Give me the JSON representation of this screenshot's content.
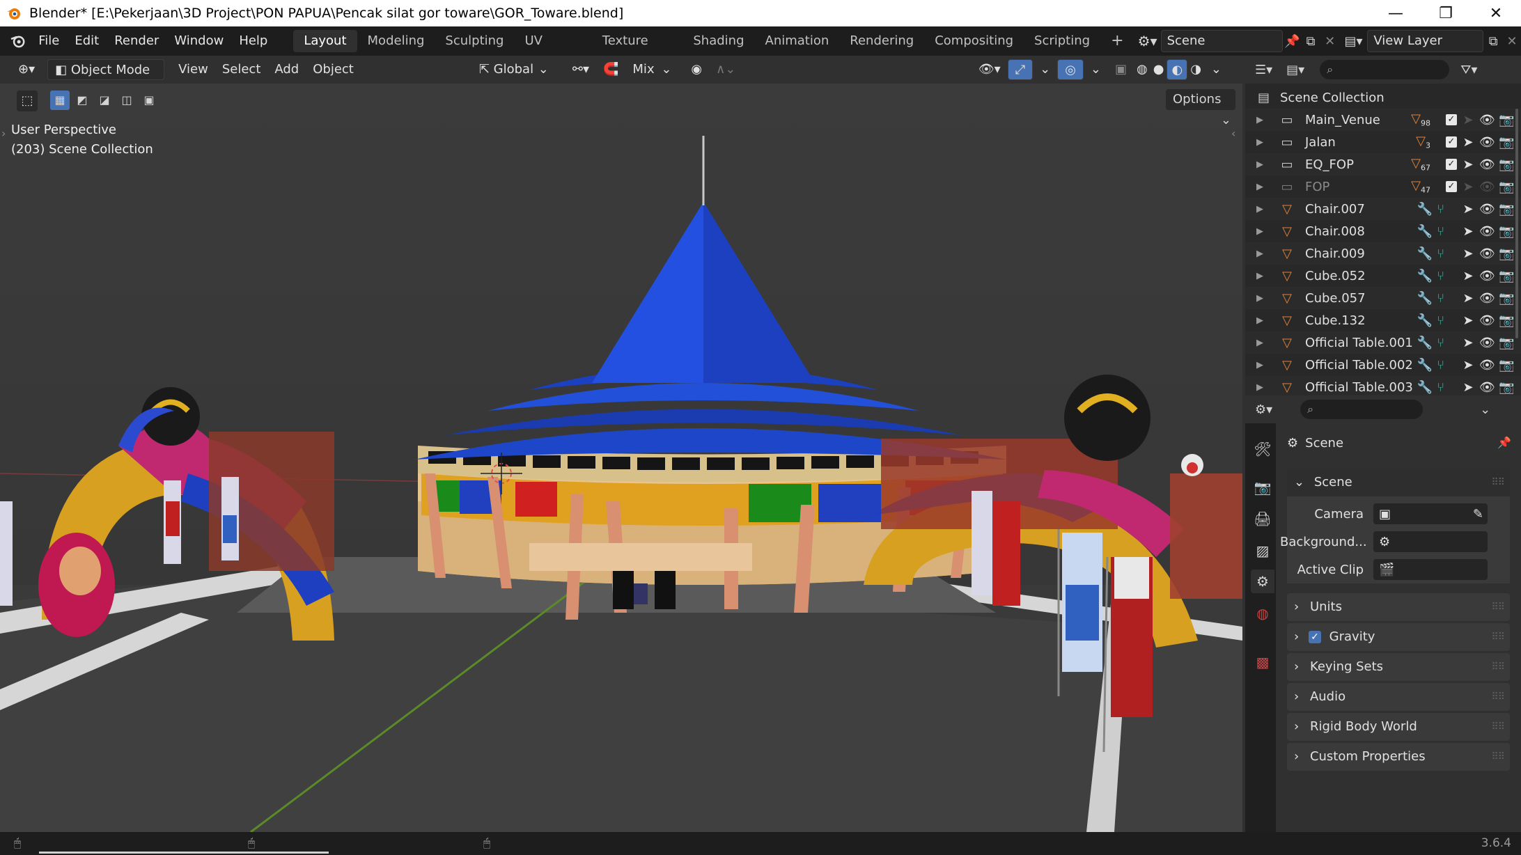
{
  "window": {
    "title": "Blender* [E:\\Pekerjaan\\3D Project\\PON PAPUA\\Pencak silat gor toware\\GOR_Toware.blend]",
    "min_label": "—",
    "max_label": "❐",
    "close_label": "✕"
  },
  "menu": {
    "items": [
      "File",
      "Edit",
      "Render",
      "Window",
      "Help"
    ],
    "workspaces": [
      "Layout",
      "Modeling",
      "Sculpting",
      "UV Editing",
      "Texture Paint",
      "Shading",
      "Animation",
      "Rendering",
      "Compositing",
      "Scripting"
    ],
    "add_tab": "+",
    "scene_name": "Scene",
    "view_layer": "View Layer"
  },
  "header": {
    "mode": "Object Mode",
    "view": "View",
    "select": "Select",
    "add": "Add",
    "object": "Object",
    "orientation": "Global",
    "pivot_mix": "Mix",
    "options": "Options"
  },
  "viewport": {
    "perspective": "User Perspective",
    "collection": "(203) Scene Collection"
  },
  "outliner": {
    "root": "Scene Collection",
    "rows": [
      {
        "name": "Main_Venue",
        "kind": "collection",
        "badge": "98"
      },
      {
        "name": "Jalan",
        "kind": "collection",
        "badge": "3"
      },
      {
        "name": "EQ_FOP",
        "kind": "collection",
        "badge": "67"
      },
      {
        "name": "FOP",
        "kind": "collection",
        "badge": "47"
      },
      {
        "name": "Chair.007",
        "kind": "mesh",
        "badge": ""
      },
      {
        "name": "Chair.008",
        "kind": "mesh",
        "badge": ""
      },
      {
        "name": "Chair.009",
        "kind": "mesh",
        "badge": ""
      },
      {
        "name": "Cube.052",
        "kind": "mesh",
        "badge": ""
      },
      {
        "name": "Cube.057",
        "kind": "mesh",
        "badge": ""
      },
      {
        "name": "Cube.132",
        "kind": "mesh",
        "badge": ""
      },
      {
        "name": "Official Table.001",
        "kind": "mesh",
        "badge": ""
      },
      {
        "name": "Official Table.002",
        "kind": "mesh",
        "badge": ""
      },
      {
        "name": "Official Table.003",
        "kind": "mesh",
        "badge": ""
      }
    ]
  },
  "properties": {
    "context": "Scene",
    "section": "Scene",
    "camera_label": "Camera",
    "background_label": "Background...",
    "active_clip_label": "Active Clip",
    "panels": [
      "Units",
      "Gravity",
      "Keying Sets",
      "Audio",
      "Rigid Body World",
      "Custom Properties"
    ]
  },
  "status": {
    "version": "3.6.4"
  },
  "colors": {
    "accent": "#4772b3",
    "roof": "#1e46c8",
    "mesh_orange": "#e4813a"
  }
}
